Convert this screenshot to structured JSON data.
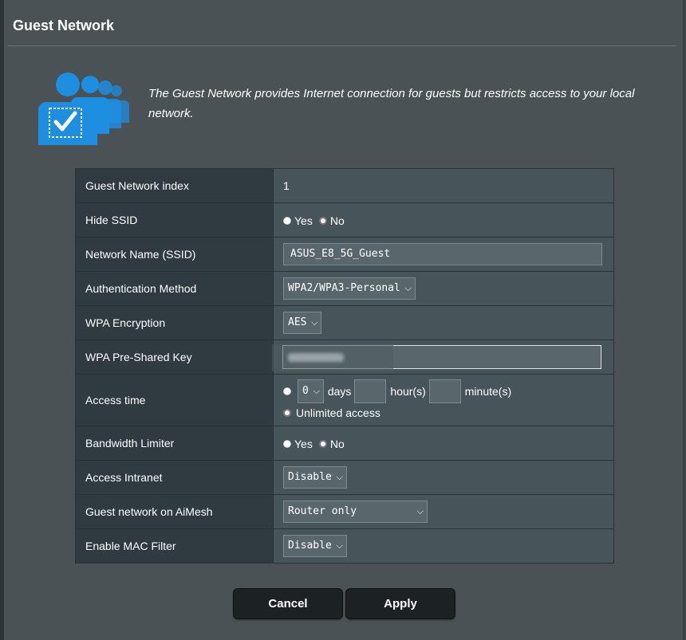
{
  "page": {
    "title": "Guest Network",
    "description": "The Guest Network provides Internet connection for guests but restricts access to your local network."
  },
  "settings": {
    "index": {
      "label": "Guest Network index",
      "value": "1"
    },
    "hide_ssid": {
      "label": "Hide SSID",
      "options": [
        "Yes",
        "No"
      ],
      "selected": "No"
    },
    "ssid": {
      "label": "Network Name (SSID)",
      "value": "ASUS_E8_5G_Guest"
    },
    "auth_method": {
      "label": "Authentication Method",
      "value": "WPA2/WPA3-Personal"
    },
    "wpa_encryption": {
      "label": "WPA Encryption",
      "value": "AES"
    },
    "psk": {
      "label": "WPA Pre-Shared Key"
    },
    "access_time": {
      "label": "Access time",
      "days_value": "0",
      "days_unit": "days",
      "hours_unit": "hour(s)",
      "minutes_unit": "minute(s)",
      "unlimited_label": "Unlimited access",
      "selected": "Unlimited access"
    },
    "bandwidth_limiter": {
      "label": "Bandwidth Limiter",
      "options": [
        "Yes",
        "No"
      ],
      "selected": "No"
    },
    "access_intranet": {
      "label": "Access Intranet",
      "value": "Disable"
    },
    "aimesh": {
      "label": "Guest network on AiMesh",
      "value": "Router only"
    },
    "mac_filter": {
      "label": "Enable MAC Filter",
      "value": "Disable"
    }
  },
  "buttons": {
    "cancel": "Cancel",
    "apply": "Apply"
  },
  "icons": {
    "banner": "guest-users-check-icon",
    "dropdown": "chevron-down-icon"
  },
  "colors": {
    "accent_blue": "#1e8ee0",
    "panel_bg": "#4a5256",
    "label_bg": "#2f3b41",
    "value_bg": "#475459"
  }
}
